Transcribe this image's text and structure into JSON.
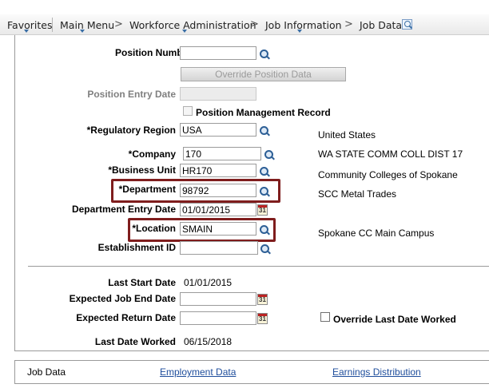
{
  "breadcrumb": {
    "items": [
      "Favorites",
      "Main Menu",
      "Workforce Administration",
      "Job Information",
      "Job Data"
    ],
    "separator": ">"
  },
  "form": {
    "position_number": {
      "label": "Position Number",
      "value": ""
    },
    "override_position_data_label": "Override Position Data",
    "position_entry_date": {
      "label": "Position Entry Date",
      "value": ""
    },
    "position_management_record_label": "Position Management Record",
    "regulatory_region": {
      "label": "*Regulatory Region",
      "value": "USA",
      "description": "United States"
    },
    "company": {
      "label": "*Company",
      "value": "170",
      "description": "WA STATE COMM COLL DIST 17"
    },
    "business_unit": {
      "label": "*Business Unit",
      "value": "HR170",
      "description": "Community Colleges of Spokane"
    },
    "department": {
      "label": "*Department",
      "value": "98792",
      "description": "SCC Metal Trades"
    },
    "department_entry_date": {
      "label": "Department Entry Date",
      "value": "01/01/2015",
      "calendar_glyph": "31"
    },
    "location": {
      "label": "*Location",
      "value": "SMAIN",
      "description": "Spokane CC Main Campus"
    },
    "establishment_id": {
      "label": "Establishment ID",
      "value": ""
    }
  },
  "dates": {
    "last_start_date": {
      "label": "Last Start Date",
      "value": "01/01/2015"
    },
    "expected_job_end_date": {
      "label": "Expected Job End Date",
      "value": ""
    },
    "expected_return_date": {
      "label": "Expected Return Date",
      "value": ""
    },
    "override_last_date_worked_label": "Override Last Date Worked",
    "last_date_worked": {
      "label": "Last Date Worked",
      "value": "06/15/2018"
    }
  },
  "tabs": [
    "Job Data",
    "Employment Data",
    "Earnings Distribution"
  ],
  "colors": {
    "highlight": "#7f1d1d",
    "link": "#1f4e9c",
    "icon": "#2d5f96"
  },
  "icons": {
    "lookup": "search-icon",
    "calendar": "calendar-icon",
    "page_search": "search-page-icon"
  }
}
